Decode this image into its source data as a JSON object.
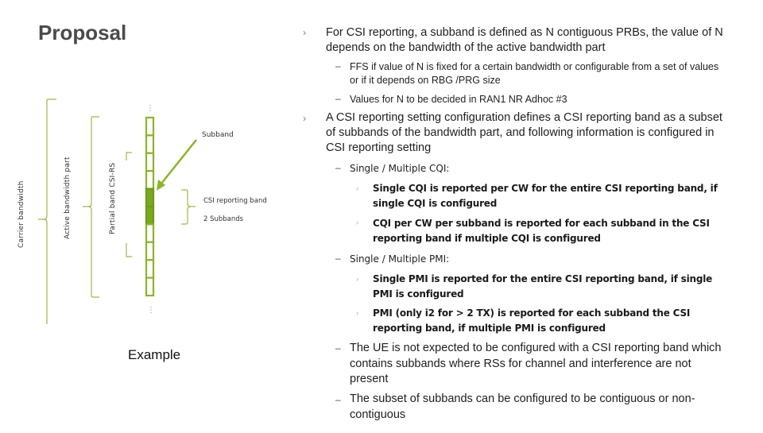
{
  "title": "Proposal",
  "diagram": {
    "labels": {
      "carrier_bandwidth": "Carrier bandwidth",
      "active_bandwidth_part": "Active bandwidth part",
      "partial_band_csi_rs": "Partial band CSI-RS",
      "subband": "Subband",
      "csi_reporting_band": "CSI reporting band",
      "two_subbands": "2 Subbands",
      "ellipsis_top": "⋮",
      "ellipsis_bottom": "⋮"
    },
    "subband_count": 10,
    "highlighted_subbands": [
      5,
      6
    ],
    "colors": {
      "green": "#8ab42c",
      "green_dark": "#6f9a1c",
      "highlight_fill": "#7aa81e",
      "bracket": "#a3b34a"
    },
    "caption": "Example"
  },
  "bullets": [
    {
      "marker": "›",
      "text": "For CSI reporting, a subband is defined as N contiguous PRBs, the value of N depends on the bandwidth of the active bandwidth part",
      "children": [
        {
          "marker": "–",
          "text": "FFS if value of N is fixed for a certain bandwidth or configurable from a set of values or if it depends on RBG /PRG size"
        },
        {
          "marker": "–",
          "text": "Values for N to be decided in RAN1 NR Adhoc #3"
        }
      ]
    },
    {
      "marker": "›",
      "text": "A CSI reporting setting configuration defines a CSI reporting band as a subset of subbands of the bandwidth part, and following information is configured in CSI reporting setting",
      "children": [
        {
          "marker": "–",
          "text": "Single / Multiple CQI:",
          "children": [
            {
              "marker": "›",
              "text": "Single CQI is reported per CW for the entire CSI reporting band, if single CQI is configured"
            },
            {
              "marker": "›",
              "text": "CQI per CW per subband is reported for each subband in the CSI reporting band if multiple CQI is configured"
            }
          ]
        },
        {
          "marker": "–",
          "text": "Single / Multiple PMI:",
          "children": [
            {
              "marker": "›",
              "text": "Single PMI is reported for the entire CSI reporting band, if single PMI is configured"
            },
            {
              "marker": "›",
              "text": "PMI (only i2 for > 2 TX) is reported for each subband the CSI reporting band, if multiple PMI is configured"
            }
          ]
        },
        {
          "marker": "–",
          "text": "The UE is not expected to be configured with a CSI reporting band which contains subbands where RSs for channel and interference are not present"
        },
        {
          "marker": "–",
          "text": "The subset of subbands can be configured to be contiguous or non-contiguous"
        }
      ]
    }
  ]
}
